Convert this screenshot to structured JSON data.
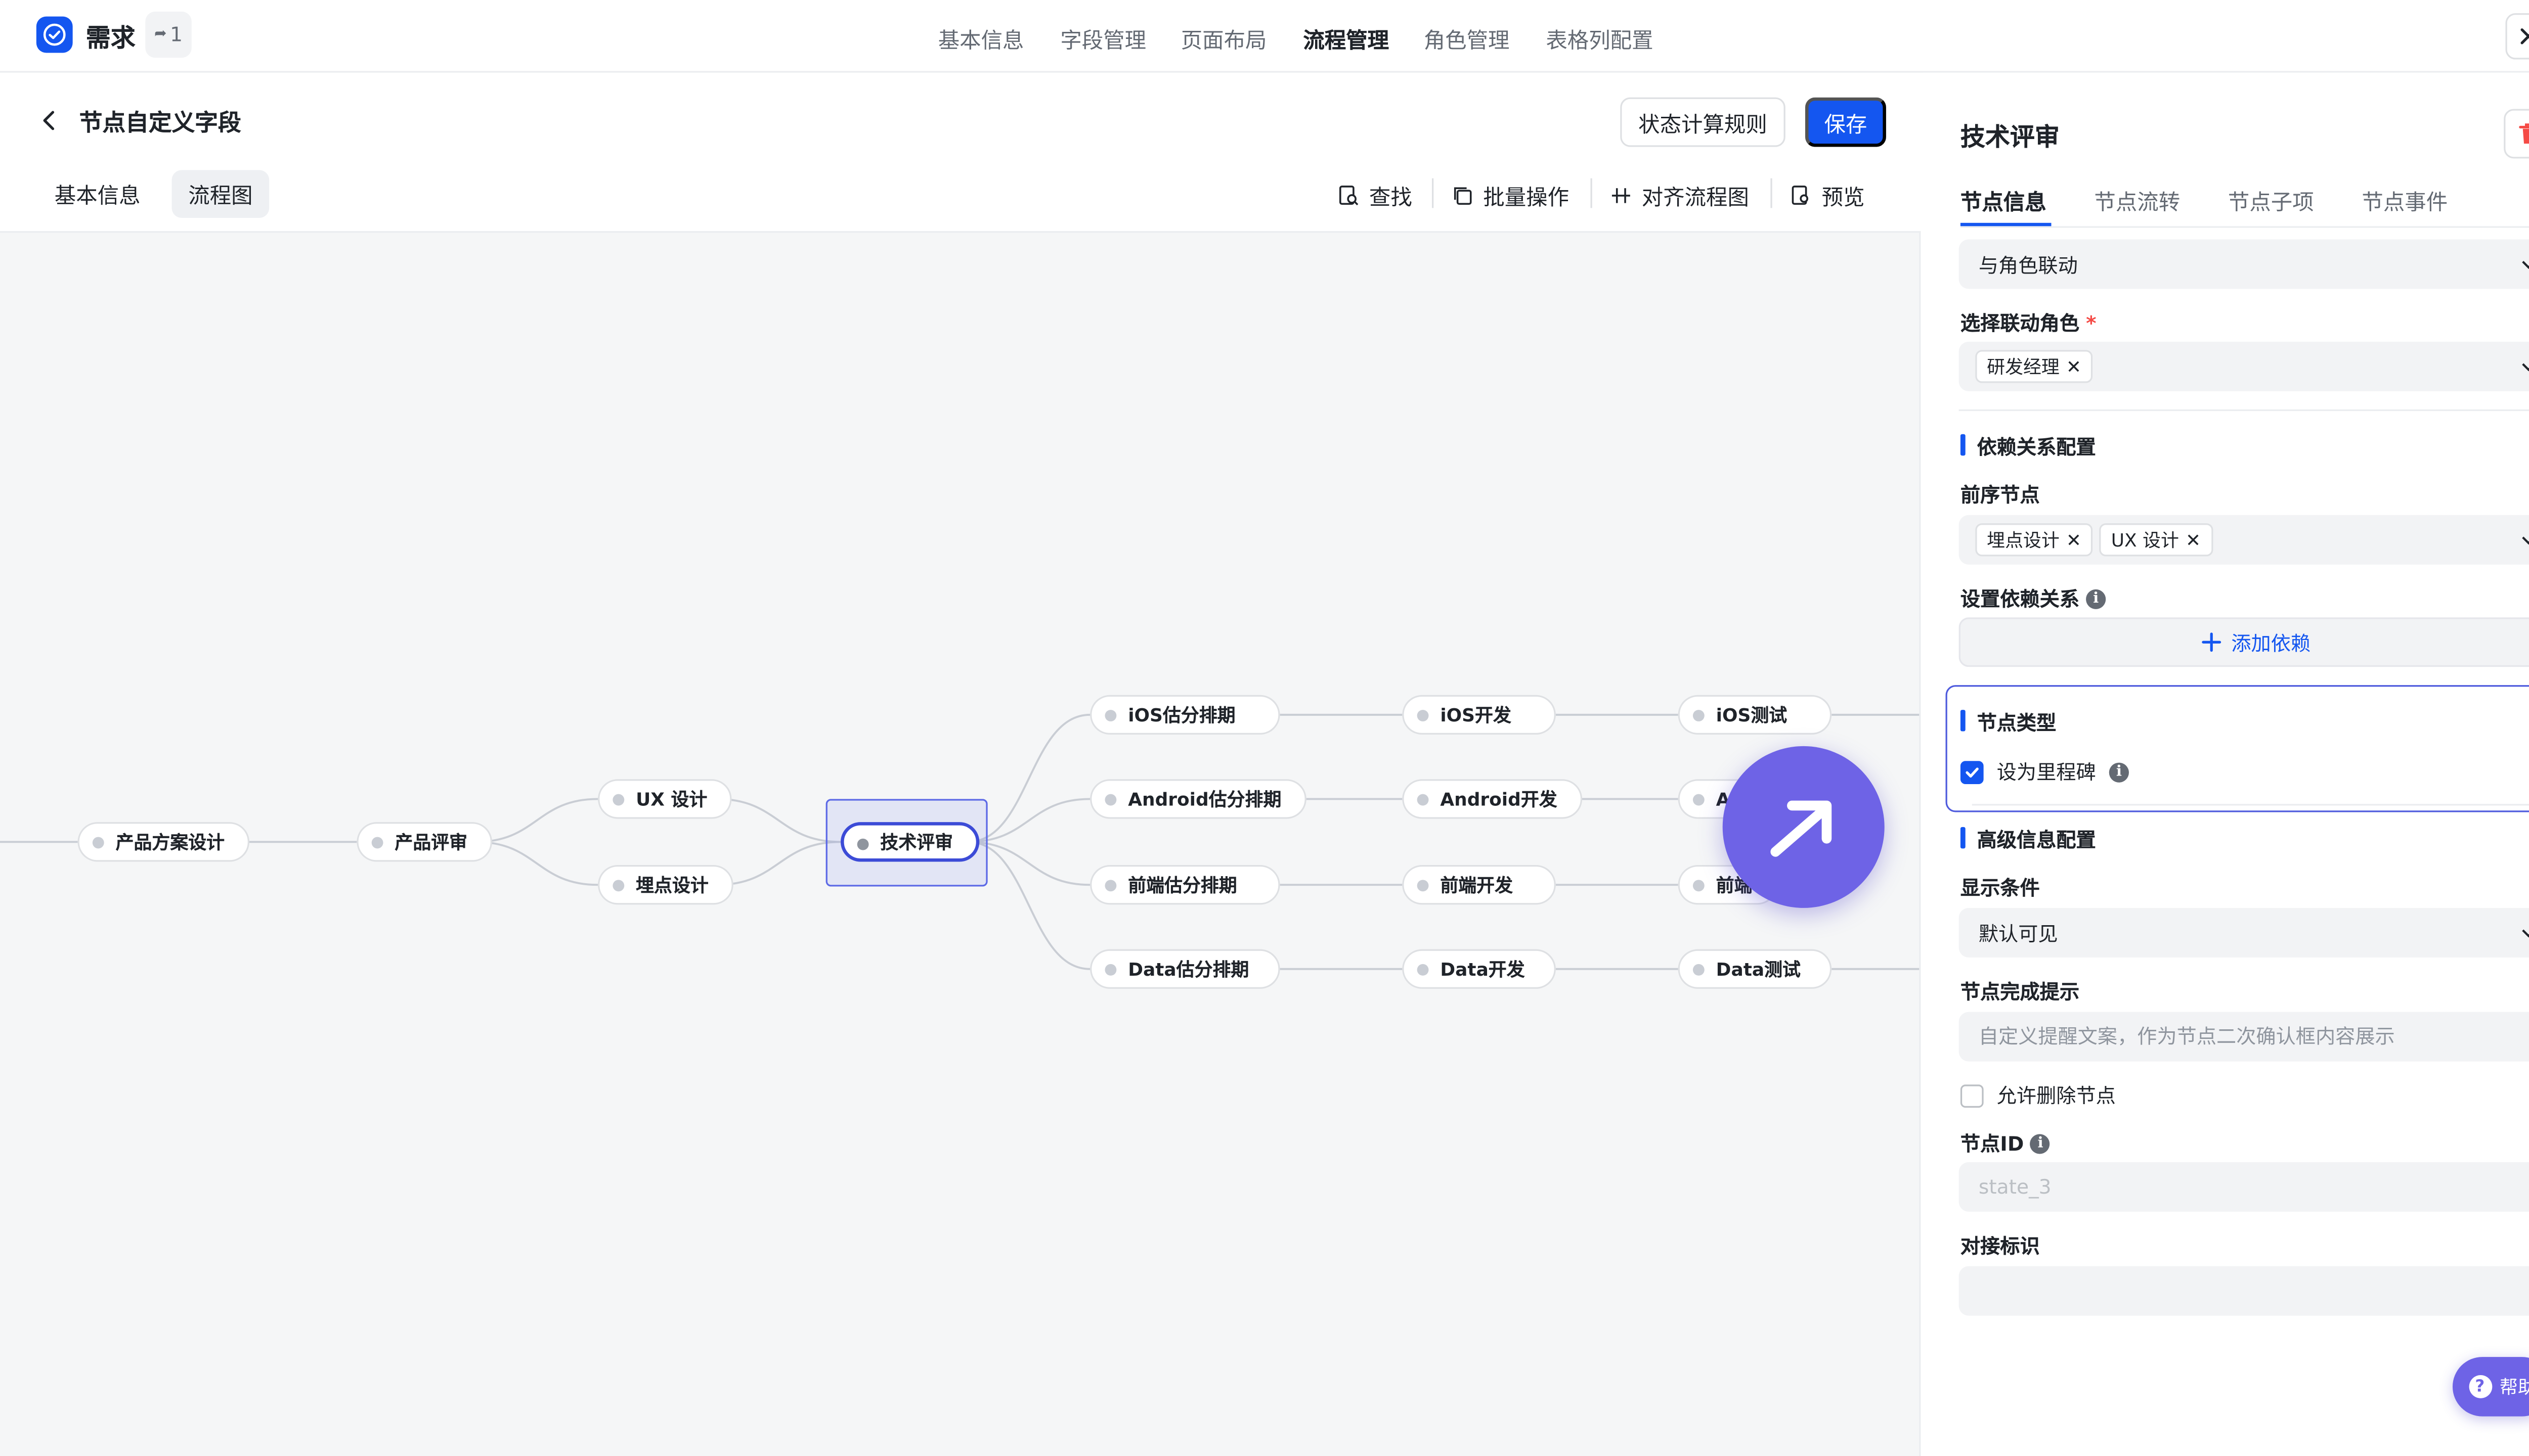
{
  "app": {
    "title": "需求",
    "share_count": "1"
  },
  "top_nav": [
    "基本信息",
    "字段管理",
    "页面布局",
    "流程管理",
    "角色管理",
    "表格列配置"
  ],
  "header": {
    "title": "节点自定义字段",
    "state_rule_label": "状态计算规则",
    "save_label": "保存"
  },
  "subtabs": [
    "基本信息",
    "流程图"
  ],
  "toolbar": {
    "find": "查找",
    "batch": "批量操作",
    "align": "对齐流程图",
    "preview": "预览"
  },
  "flow": {
    "nodes": [
      {
        "id": "n1",
        "label": "产品方案设计"
      },
      {
        "id": "n2",
        "label": "产品评审"
      },
      {
        "id": "n3",
        "label": "UX 设计"
      },
      {
        "id": "n4",
        "label": "埋点设计"
      },
      {
        "id": "n5",
        "label": "技术评审"
      },
      {
        "id": "n6",
        "label": "iOS估分排期"
      },
      {
        "id": "n7",
        "label": "Android估分排期"
      },
      {
        "id": "n8",
        "label": "前端估分排期"
      },
      {
        "id": "n9",
        "label": "Data估分排期"
      },
      {
        "id": "n10",
        "label": "iOS开发"
      },
      {
        "id": "n11",
        "label": "Android开发"
      },
      {
        "id": "n12",
        "label": "前端开发"
      },
      {
        "id": "n13",
        "label": "Data开发"
      },
      {
        "id": "n14",
        "label": "iOS测试"
      },
      {
        "id": "n15",
        "label": "An"
      },
      {
        "id": "n16",
        "label": "前端"
      },
      {
        "id": "n17",
        "label": "Data测试"
      }
    ],
    "selected": "技术评审"
  },
  "panel": {
    "title": "技术评审",
    "tabs": [
      "节点信息",
      "节点流转",
      "节点子项",
      "节点事件"
    ],
    "role_link_value": "与角色联动",
    "role_select_label": "选择联动角色",
    "role_tags": [
      "研发经理"
    ],
    "dependency_section": "依赖关系配置",
    "predecessor_label": "前序节点",
    "predecessor_tags": [
      "埋点设计",
      "UX 设计"
    ],
    "set_dependency_label": "设置依赖关系",
    "add_dependency_label": "添加依赖",
    "node_type_section": "节点类型",
    "milestone_label": "设为里程碑",
    "advanced_section": "高级信息配置",
    "display_condition_label": "显示条件",
    "display_condition_value": "默认可见",
    "completion_tip_label": "节点完成提示",
    "completion_tip_placeholder": "自定义提醒文案，作为节点二次确认框内容展示",
    "allow_delete_label": "允许删除节点",
    "node_id_label": "节点ID",
    "node_id_placeholder": "state_3",
    "docking_label": "对接标识",
    "help_label": "帮助"
  },
  "colors": {
    "primary": "#1456f0",
    "accent": "#6e63e6",
    "selected_node": "#3c4bd7",
    "danger": "#f54a45"
  },
  "icons": [
    "check-circle-icon",
    "share-icon",
    "close-icon",
    "back-chevron-icon",
    "search-doc-icon",
    "copy-icon",
    "align-icon",
    "preview-icon",
    "arrow-up-right-icon",
    "trash-icon",
    "chevron-down-icon",
    "plus-icon",
    "info-icon",
    "help-icon"
  ]
}
